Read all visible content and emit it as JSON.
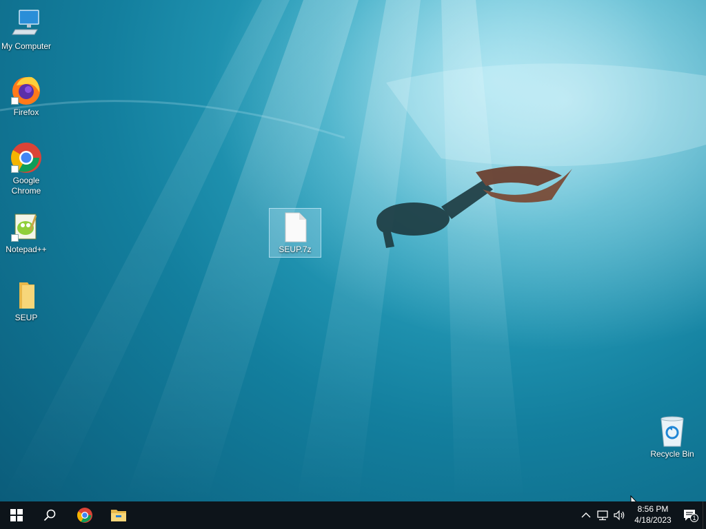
{
  "desktop": {
    "icons": [
      {
        "label": "My Computer",
        "icon": "computer-icon"
      },
      {
        "label": "Firefox",
        "icon": "firefox-icon",
        "shortcut": true
      },
      {
        "label": "Google Chrome",
        "icon": "chrome-icon",
        "shortcut": true
      },
      {
        "label": "Notepad++",
        "icon": "notepadpp-icon",
        "shortcut": true
      },
      {
        "label": "SEUP",
        "icon": "folder-icon"
      },
      {
        "label": "SEUP.7z",
        "icon": "file-icon",
        "selected": true
      },
      {
        "label": "Recycle Bin",
        "icon": "recycle-bin-icon"
      }
    ]
  },
  "taskbar": {
    "start_icon": "windows-logo-icon",
    "search_icon": "search-icon",
    "pinned": [
      {
        "name": "Google Chrome",
        "icon": "chrome-icon"
      },
      {
        "name": "File Explorer",
        "icon": "file-explorer-icon"
      }
    ],
    "tray": {
      "icons": [
        "chevron-up-icon",
        "network-icon",
        "volume-icon"
      ],
      "time": "8:56 PM",
      "date": "4/18/2023",
      "notifications_count": "1"
    }
  },
  "colors": {
    "taskbar_bg": "#0d141a",
    "wallpaper_deep": "#0a5a78",
    "wallpaper_light": "#7fd4e6",
    "selection": "#a0d7eb"
  }
}
